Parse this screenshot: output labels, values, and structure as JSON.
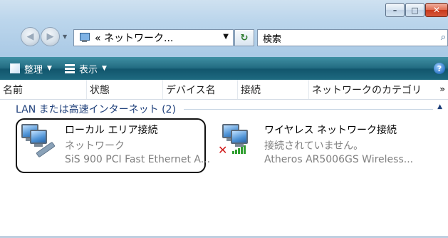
{
  "window": {
    "buttons": {
      "minimize": "–",
      "maximize": "□",
      "close": "✕"
    }
  },
  "nav": {
    "back_glyph": "◀",
    "forward_glyph": "▶",
    "address_text": "« ネットワーク...",
    "address_dropdown_glyph": "▼",
    "refresh_glyph": "↻",
    "search_placeholder": "検索",
    "search_glyph": "⌕"
  },
  "commandbar": {
    "organize_label": "整理",
    "view_label": "表示",
    "dropdown_glyph": "▼",
    "help_glyph": "?"
  },
  "columns": {
    "headers": [
      "名前",
      "状態",
      "デバイス名",
      "接続",
      "ネットワークのカテゴリ"
    ],
    "more_glyph": "»"
  },
  "group": {
    "label": "LAN または高速インターネット (2)",
    "toggle_glyph": "▲"
  },
  "items": [
    {
      "name": "ローカル エリア接続",
      "status": "ネットワーク",
      "device": "SiS 900 PCI Fast Ethernet A...",
      "icon": "network-connection-icon"
    },
    {
      "name": "ワイヤレス ネットワーク接続",
      "status": "接続されていません。",
      "device": "Atheros AR5006GS Wireless...",
      "icon": "wireless-connection-icon"
    }
  ],
  "colors": {
    "commandbar": "#1e6a80",
    "group_text": "#1e3f7a",
    "status_gray": "#808080",
    "disconnected_red": "#d01a1a",
    "signal_green": "#2f9e2f"
  }
}
